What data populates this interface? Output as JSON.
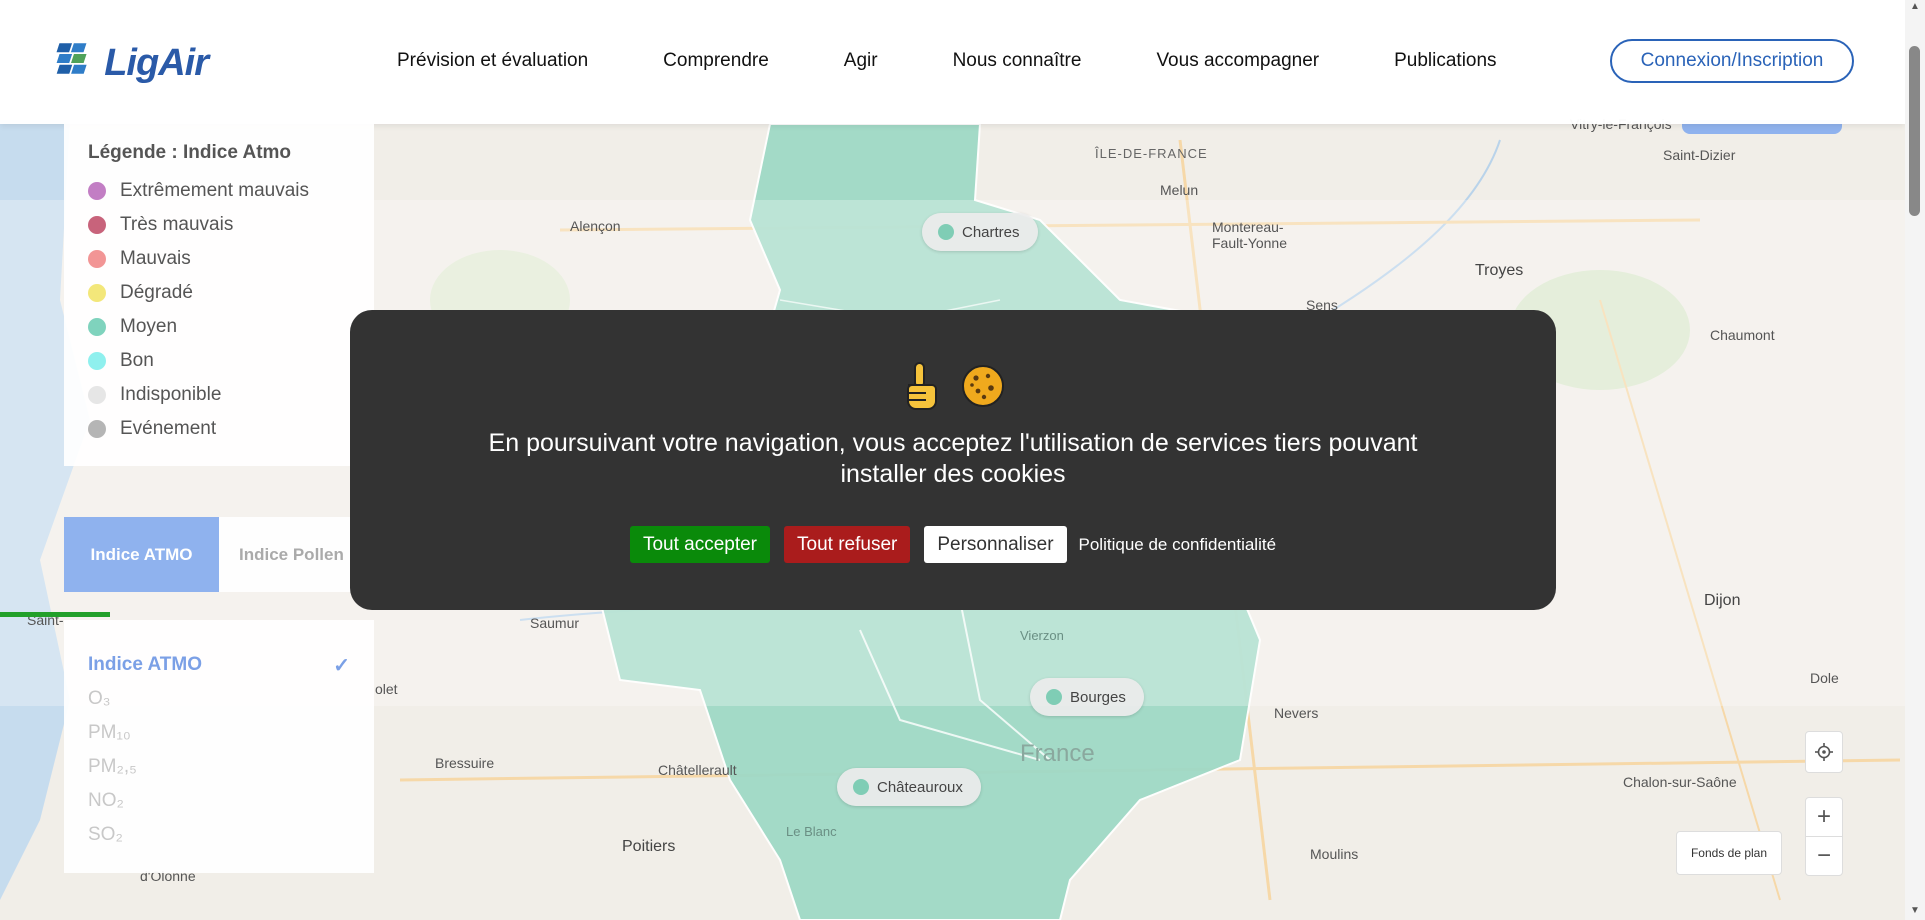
{
  "header": {
    "logo_text": "LigAir",
    "nav": [
      "Prévision et évaluation",
      "Comprendre",
      "Agir",
      "Nous connaître",
      "Vous accompagner",
      "Publications"
    ],
    "login_label": "Connexion/Inscription"
  },
  "legend": {
    "title": "Légende : Indice Atmo",
    "items": [
      {
        "label": "Extrêmement mauvais",
        "color": "#c27ec4"
      },
      {
        "label": "Très mauvais",
        "color": "#c8637b"
      },
      {
        "label": "Mauvais",
        "color": "#f29595"
      },
      {
        "label": "Dégradé",
        "color": "#f3e77a"
      },
      {
        "label": "Moyen",
        "color": "#7fd3bd"
      },
      {
        "label": "Bon",
        "color": "#8ff0ee"
      },
      {
        "label": "Indisponible",
        "color": "#e6e6e6"
      },
      {
        "label": "Evénement",
        "color": "#b5b5b5"
      }
    ]
  },
  "tabs": {
    "atmo": "Indice ATMO",
    "pollen": "Indice Pollen"
  },
  "pollutants": {
    "items": [
      "Indice ATMO",
      "O₃",
      "PM₁₀",
      "PM₂,₅",
      "NO₂",
      "SO₂"
    ],
    "selected": "Indice ATMO"
  },
  "map": {
    "pills": [
      "Chartres",
      "Bourges",
      "Châteauroux"
    ],
    "labels": {
      "vitry": "Vitry-le-François",
      "saint_dizier": "Saint-Dizier",
      "ile_de_france": "ÎLE-DE-FRANCE",
      "melun": "Melun",
      "alencon": "Alençon",
      "montereau": "Montereau-\nFault-Yonne",
      "troyes": "Troyes",
      "sens": "Sens",
      "chaumont": "Chaumont",
      "saumur": "Saumur",
      "dijon": "Dijon",
      "dole": "Dole",
      "nevers": "Nevers",
      "cholet": "olet",
      "bressuire": "Bressuire",
      "chatellerault": "Châtellerault",
      "chalon": "Chalon-sur-Saône",
      "poitiers": "Poitiers",
      "moulins": "Moulins",
      "olonne": "d'Olonne",
      "france": "France",
      "vierzon": "Vierzon",
      "blanc": "Le Blanc",
      "saint": "Saint-"
    }
  },
  "controls": {
    "basemap_label": "Fonds de plan",
    "zoom_in": "+",
    "zoom_out": "−"
  },
  "cookie": {
    "icons": [
      "hand-pointing-up-icon",
      "cookie-icon"
    ],
    "message": "En poursuivant votre navigation, vous acceptez l'utilisation de services tiers pouvant installer des cookies",
    "accept": "Tout accepter",
    "refuse": "Tout refuser",
    "customize": "Personnaliser",
    "policy": "Politique de confidentialité"
  }
}
